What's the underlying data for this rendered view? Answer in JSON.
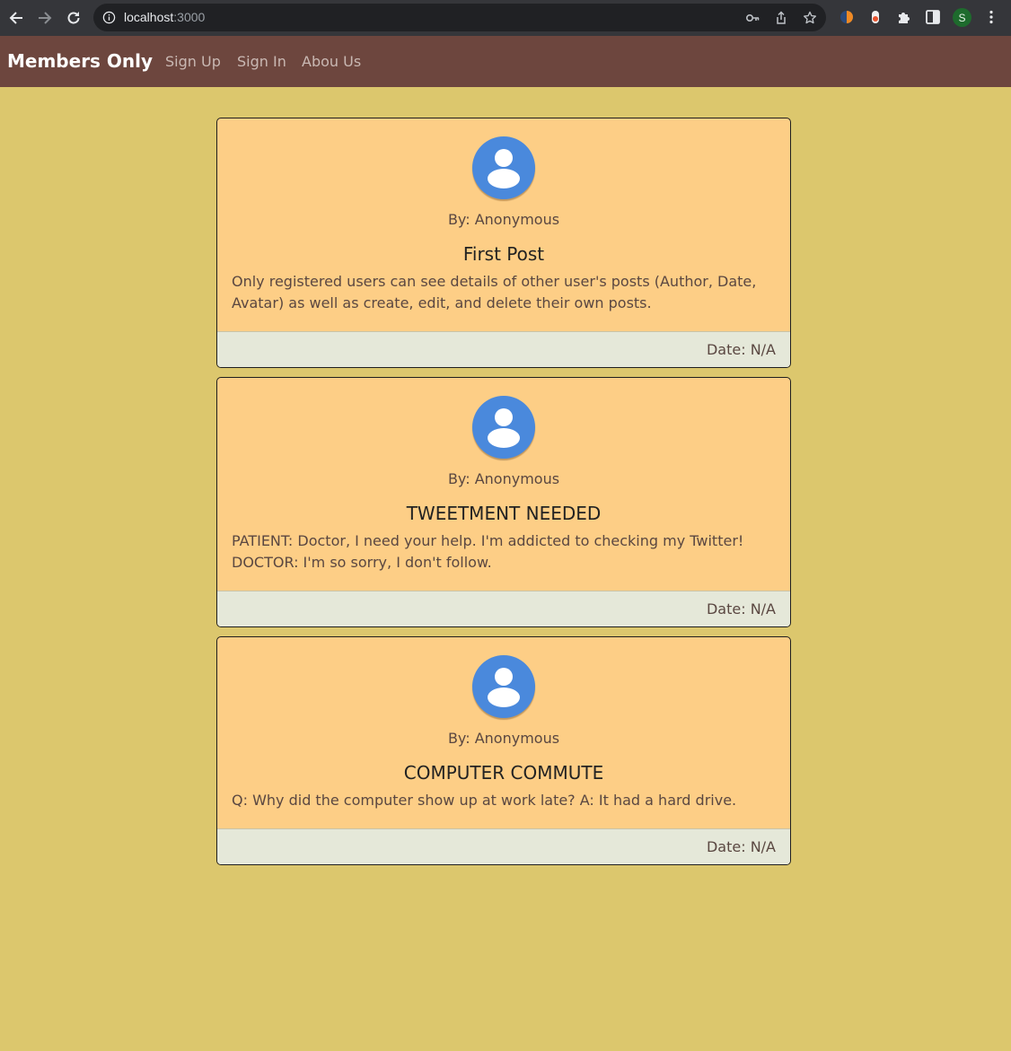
{
  "browser": {
    "url_host": "localhost",
    "url_port": ":3000",
    "profile_initial": "S",
    "icons": [
      "back-icon",
      "forward-icon",
      "reload-icon",
      "info-icon",
      "key-icon",
      "share-icon",
      "star-icon",
      "extension-1-icon",
      "extension-2-icon",
      "puzzle-icon",
      "sidepanel-icon",
      "kebab-menu-icon"
    ]
  },
  "navbar": {
    "brand": "Members Only",
    "links": [
      "Sign Up",
      "Sign In",
      "Abou Us"
    ]
  },
  "colors": {
    "page_bg": "#dcc76d",
    "navbar_bg": "#6d463e",
    "card_bg": "#fdce86",
    "card_footer_bg": "#e5e8d9",
    "avatar_bg": "#4a89dc"
  },
  "posts": [
    {
      "author": "By: Anonymous",
      "title": "First Post",
      "body": "Only registered users can see details of other user's posts (Author, Date, Avatar) as well as create, edit, and delete their own posts.",
      "date": "Date: N/A"
    },
    {
      "author": "By: Anonymous",
      "title": "TWEETMENT NEEDED",
      "body": "PATIENT: Doctor, I need your help. I'm addicted to checking my Twitter! DOCTOR: I'm so sorry, I don't follow.",
      "date": "Date: N/A"
    },
    {
      "author": "By: Anonymous",
      "title": "COMPUTER COMMUTE",
      "body": "Q: Why did the computer show up at work late? A: It had a hard drive.",
      "date": "Date: N/A"
    }
  ]
}
